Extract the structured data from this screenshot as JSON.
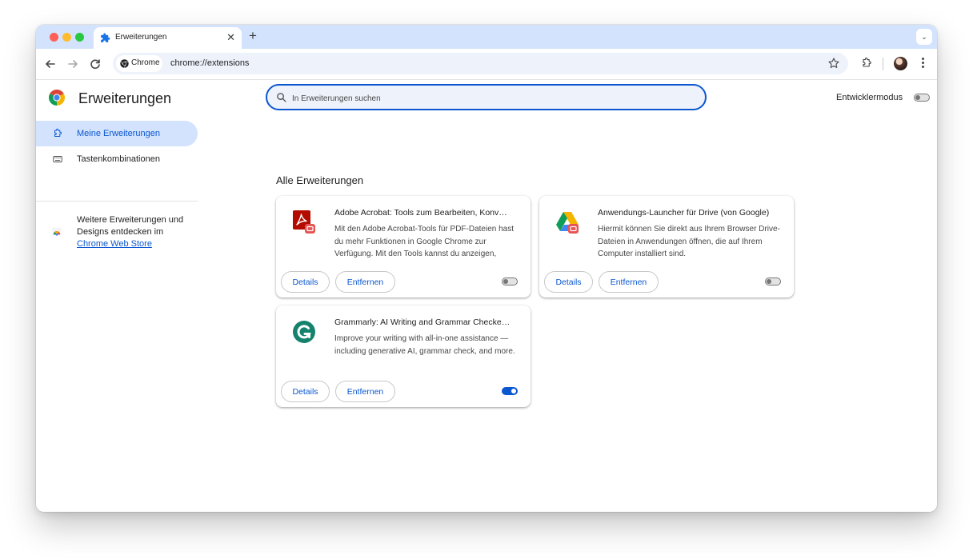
{
  "browser": {
    "tab": {
      "title": "Erweiterungen",
      "close_glyph": "✕"
    },
    "new_tab_glyph": "+",
    "tab_menu_glyph": "⌄",
    "omnibox": {
      "chip_label": "Chrome",
      "url": "chrome://extensions"
    }
  },
  "sidebar": {
    "title": "Erweiterungen",
    "items": [
      {
        "label": "Meine Erweiterungen",
        "icon": "extension-puzzle-icon",
        "active": true
      },
      {
        "label": "Tastenkombinationen",
        "icon": "keyboard-icon",
        "active": false
      }
    ],
    "store": {
      "text": "Weitere Erweiterungen und Designs entdecken im",
      "link": "Chrome Web Store"
    }
  },
  "search": {
    "placeholder": "In Erweiterungen suchen",
    "value": ""
  },
  "developer_mode": {
    "label": "Entwicklermodus",
    "enabled": false
  },
  "main": {
    "section_title": "Alle Erweiterungen",
    "extensions": [
      {
        "name": "Adobe Acrobat: Tools zum Bearbeiten, Konv…",
        "description": "Mit den Adobe Acrobat-Tools für PDF-Dateien hast du mehr Funktionen in Google Chrome zur Verfügung. Mit den Tools kannst du anzeigen,",
        "icon": "adobe-acrobat-icon",
        "enabled": false,
        "details_label": "Details",
        "remove_label": "Entfernen"
      },
      {
        "name": "Anwendungs-Launcher für Drive (von Google)",
        "description": "Hiermit können Sie direkt aus Ihrem Browser Drive-Dateien in Anwendungen öffnen, die auf Ihrem Computer installiert sind.",
        "icon": "google-drive-icon",
        "enabled": false,
        "details_label": "Details",
        "remove_label": "Entfernen"
      },
      {
        "name": "Grammarly: AI Writing and Grammar Checke…",
        "description": "Improve your writing with all-in-one assistance —including generative AI, grammar check, and more.",
        "icon": "grammarly-icon",
        "enabled": true,
        "details_label": "Details",
        "remove_label": "Entfernen"
      }
    ]
  },
  "colors": {
    "accent": "#0b57d0",
    "tabstrip": "#d3e3fd",
    "active_item_bg": "#d3e3fd"
  }
}
